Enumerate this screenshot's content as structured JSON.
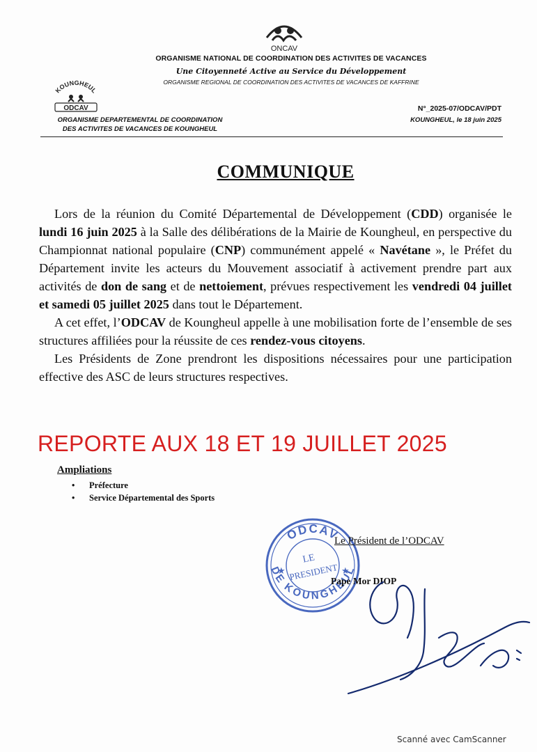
{
  "header": {
    "logo_text": "ONCAV",
    "org_national": "ORGANISME NATIONAL DE COORDINATION DES ACTIVITES DE VACANCES",
    "slogan": "Une Citoyenneté Active au Service du Développement",
    "org_regional": "ORGANISME REGIONAL DE COORDINATION DES ACTIVITES DE VACANCES DE KAFFRINE",
    "left_logo_top": "KOUNGHEUL",
    "left_logo_bottom": "ODCAV",
    "org_dept_line1": "ORGANISME DEPARTEMENTAL DE COORDINATION",
    "org_dept_line2": "DES ACTIVITES DE VACANCES DE KOUNGHEUL",
    "ref_number": "N°_2025-07/ODCAV/PDT",
    "place_date": "KOUNGHEUL, le 18 juin 2025"
  },
  "title": "COMMUNIQUE",
  "body": {
    "p1": {
      "s1": "Lors de la réunion du Comité Départemental de Développement (",
      "b1": "CDD",
      "s2": ") organisée le ",
      "b2": "lundi 16 juin 2025",
      "s3": " à la Salle des délibérations de la Mairie de Koungheul, en perspective du Championnat national populaire (",
      "b3": "CNP",
      "s4": ") communément appelé « ",
      "b4": "Navétane",
      "s5": " », le Préfet du Département invite les acteurs du Mouvement associatif à activement prendre part aux activités de ",
      "b5": "don de sang",
      "s6": " et de ",
      "b6": "nettoiement",
      "s7": ", prévues respectivement les ",
      "b7": "vendredi 04 juillet et samedi 05 juillet 2025",
      "s8": " dans tout le Département."
    },
    "p2": {
      "s1": "A cet effet, l’",
      "b1": "ODCAV",
      "s2": " de Koungheul appelle à une mobilisation forte de l’ensemble de ses structures affiliées pour la réussite de ces ",
      "b2": "rendez-vous citoyens",
      "s3": "."
    },
    "p3": "Les Présidents de Zone prendront les dispositions nécessaires pour une participation effective des ASC de leurs structures respectives."
  },
  "report_notice": "REPORTE AUX 18 ET 19 JUILLET 2025",
  "ampliations": {
    "title": "Ampliations",
    "items": [
      "Préfecture",
      "Service Départemental des Sports"
    ]
  },
  "signature_block": {
    "title": "Le Président de l’ODCAV",
    "name": "Pape Mor DIOP"
  },
  "stamp": {
    "outer_top": "ODCAV",
    "outer_bottom": "DE KOUNGHEUL",
    "inner_line1": "LE",
    "inner_line2": "PRESIDENT"
  },
  "footer": {
    "scanner_mark": "Scanné avec CamScanner"
  },
  "colors": {
    "report_red": "#d61f1f",
    "stamp_blue": "#2a4fb5",
    "ink_navy": "#142a6e"
  }
}
